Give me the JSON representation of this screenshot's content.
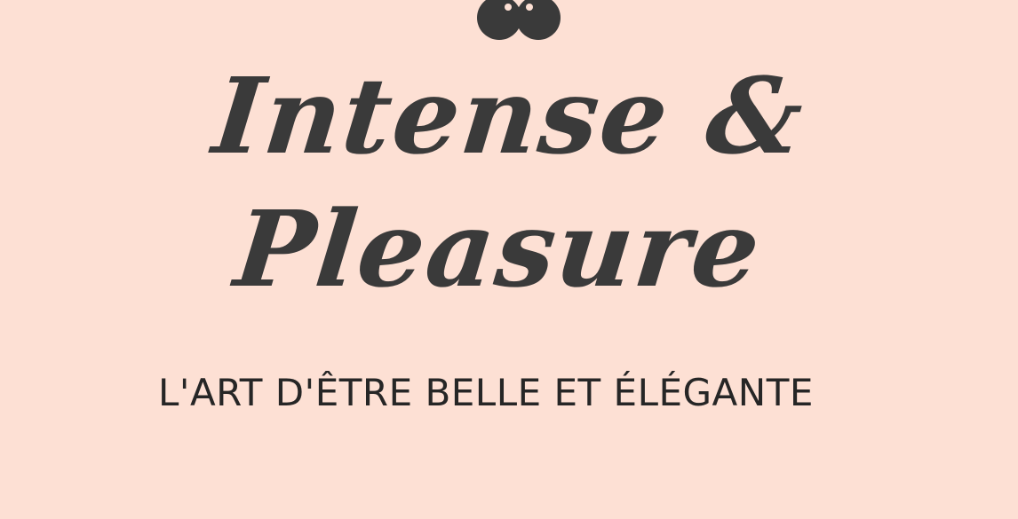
{
  "colors": {
    "background": "#fde0d4",
    "headline": "#3a3a3a",
    "tagline": "#262626"
  },
  "logo": {
    "icon": "double-circle-mark-icon"
  },
  "headline": {
    "line1": "Intense &",
    "line2": "Pleasure"
  },
  "tagline": "L'ART D'ÊTRE BELLE ET ÉLÉGANTE"
}
